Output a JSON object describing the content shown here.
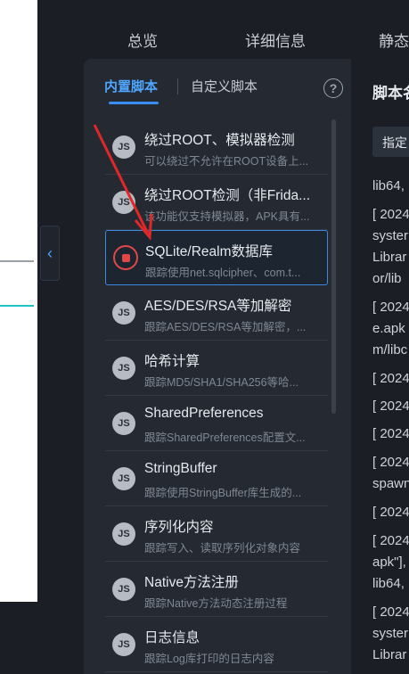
{
  "top_tabs": [
    "总览",
    "详细信息",
    "静态"
  ],
  "panel": {
    "tab_builtin": "内置脚本",
    "tab_custom": "自定义脚本",
    "help_label": "?"
  },
  "badge_label": "JS",
  "scripts": [
    {
      "title": "绕过ROOT、模拟器检测",
      "desc": "可以绕过不允许在ROOT设备上..."
    },
    {
      "title": "绕过ROOT检测（非Frida...",
      "desc": "该功能仅支持模拟器，APK具有..."
    },
    {
      "title": "SQLite/Realm数据库",
      "desc": "跟踪使用net.sqlcipher、com.t..."
    },
    {
      "title": "AES/DES/RSA等加解密",
      "desc": "跟踪AES/DES/RSA等加解密，..."
    },
    {
      "title": "哈希计算",
      "desc": "跟踪MD5/SHA1/SHA256等哈..."
    },
    {
      "title": "SharedPreferences",
      "desc": "跟踪SharedPreferences配置文..."
    },
    {
      "title": "StringBuffer",
      "desc": "跟踪使用StringBuffer库生成的..."
    },
    {
      "title": "序列化内容",
      "desc": "跟踪写入、读取序列化对象内容"
    },
    {
      "title": "Native方法注册",
      "desc": "跟踪Native方法动态注册过程"
    },
    {
      "title": "日志信息",
      "desc": "跟踪Log库打印的日志内容"
    }
  ],
  "right": {
    "title": "脚本名",
    "button": "指定",
    "log_lines": [
      "lib64,",
      "[ 2024",
      "syster",
      "Librar",
      "or/lib",
      "[ 2024",
      "e.apk",
      "m/libc",
      "[ 2024",
      "[ 2024",
      "[ 2024",
      "[ 2024",
      "spawn",
      "[ 2024",
      "[ 2024",
      "apk\"],",
      "lib64,",
      "[ 2024",
      "syster",
      "Librar"
    ]
  }
}
